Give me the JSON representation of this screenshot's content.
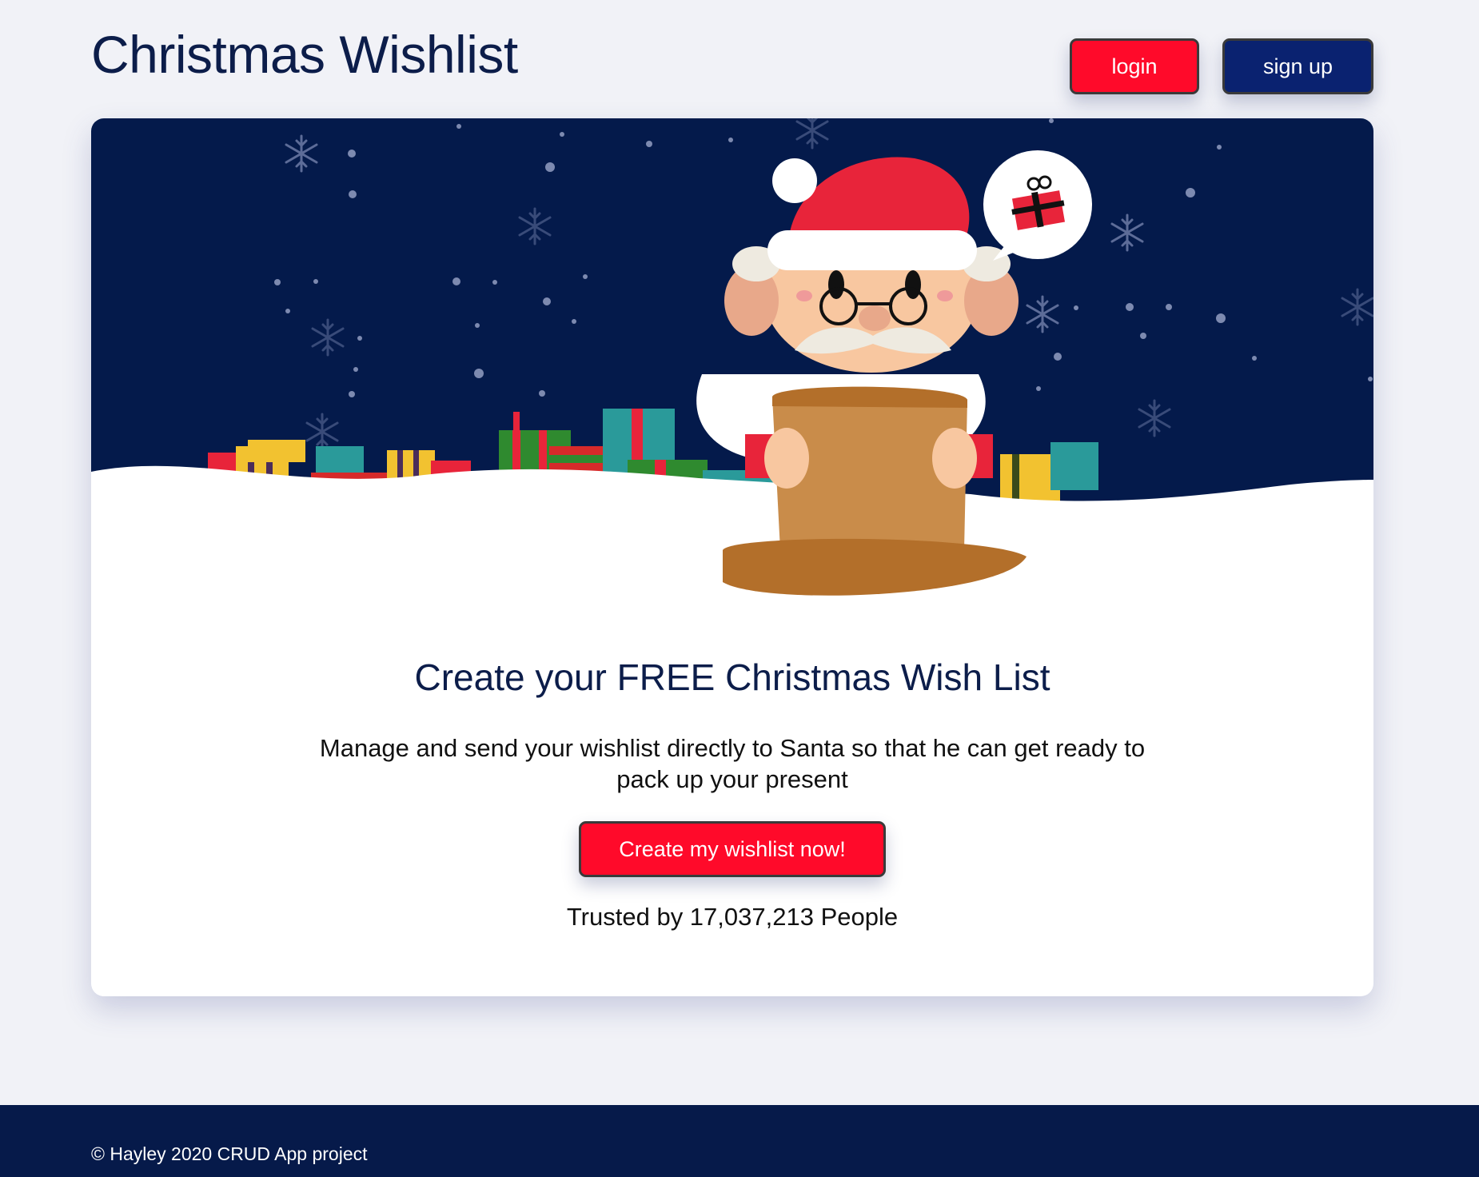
{
  "header": {
    "title": "Christmas Wishlist",
    "login_label": "login",
    "signup_label": "sign up"
  },
  "hero": {
    "headline": "Create your FREE Christmas Wish List",
    "subtext": "Manage and send your wishlist directly to Santa so that he can get ready to pack up your present",
    "cta_label": "Create my wishlist now!",
    "trusted_text": "Trusted by 17,037,213 People",
    "illustration": "santa-reading-scroll-with-presents",
    "icons": [
      "snowflake-icon",
      "gift-icon"
    ]
  },
  "footer": {
    "copyright": "© Hayley 2020 CRUD App project"
  },
  "colors": {
    "page_bg": "#f1f2f7",
    "navy": "#061a4a",
    "title_text": "#0c1d4a",
    "accent_red": "#ff0a2a",
    "signup_blue": "#0a2270",
    "card_bg": "#ffffff"
  }
}
